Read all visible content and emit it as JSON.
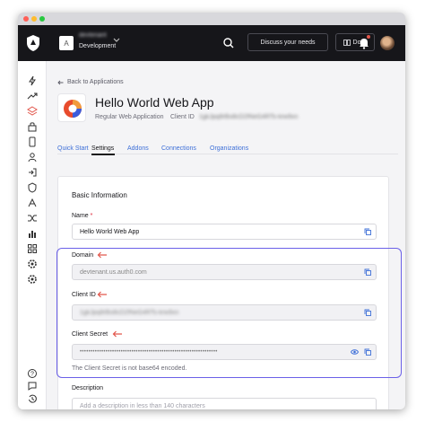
{
  "topbar": {
    "tenant_initial": "A",
    "tenant_name": "devtenant",
    "tenant_env": "Development",
    "discuss_label": "Discuss your needs",
    "docs_label": "Docs"
  },
  "sidebar": {
    "icons": [
      "bolt-icon",
      "trending-icon",
      "layers-icon",
      "lock-icon",
      "device-icon",
      "user-icon",
      "login-icon",
      "shield-icon",
      "branding-icon",
      "shuffle-icon",
      "chart-icon",
      "extensions-icon",
      "settings-icon",
      "settings-alt-icon",
      "help-icon",
      "chat-icon",
      "history-icon"
    ]
  },
  "header": {
    "back_label": "Back to Applications",
    "app_title": "Hello World Web App",
    "app_type": "Regular Web Application",
    "client_id_label": "Client ID",
    "client_id_value": "1gkJpq8rBo8cD2fNeG4RTs-krw9xn"
  },
  "tabs": [
    "Quick Start",
    "Settings",
    "Addons",
    "Connections",
    "Organizations"
  ],
  "card": {
    "title": "Basic Information",
    "name_label": "Name",
    "name_required": "*",
    "name_value": "Hello World Web App",
    "domain_label": "Domain",
    "domain_value": "devtenant.us.auth0.com",
    "client_id_label": "Client ID",
    "client_id_value": "1gkJpq8rBo8cD2fNeG4RTs-krw9xn",
    "client_secret_label": "Client Secret",
    "client_secret_value": "••••••••••••••••••••••••••••••••••••••••••••••••••••••••••••••••",
    "client_secret_hint": "The Client Secret is not base64 encoded.",
    "description_label": "Description",
    "description_placeholder": "Add a description in less than 140 characters"
  },
  "colors": {
    "accent": "#3d6fd8",
    "highlight": "#6b60e8",
    "arrow": "#e2574c",
    "topbar": "#16161a"
  }
}
